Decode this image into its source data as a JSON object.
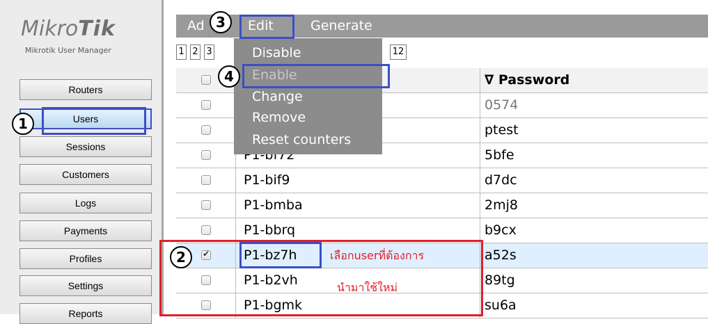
{
  "app": {
    "logo_text": "MikroTik",
    "subtitle": "Mikrotik User Manager"
  },
  "sidebar": {
    "items": [
      {
        "label": "Routers"
      },
      {
        "label": "Users"
      },
      {
        "label": "Sessions"
      },
      {
        "label": "Customers"
      },
      {
        "label": "Logs"
      },
      {
        "label": "Payments"
      },
      {
        "label": "Profiles"
      },
      {
        "label": "Settings"
      },
      {
        "label": "Reports"
      }
    ],
    "active_item": "Users"
  },
  "menubar": {
    "items": [
      "Ad",
      "Edit",
      "Generate"
    ]
  },
  "pager": {
    "pages": [
      "1",
      "2",
      "3",
      "12"
    ]
  },
  "edit_menu": {
    "items": [
      {
        "label": "Disable",
        "enabled": true
      },
      {
        "label": "Enable",
        "enabled": false
      },
      {
        "label": "Change",
        "enabled": true
      },
      {
        "label": "Remove",
        "enabled": true
      },
      {
        "label": "Reset counters",
        "enabled": true
      }
    ]
  },
  "table": {
    "columns": {
      "password": "∇ Password"
    },
    "rows": [
      {
        "username": "",
        "password": "0574",
        "checked": false
      },
      {
        "username": "",
        "password": "ptest",
        "checked": false
      },
      {
        "username": "P1-bf72",
        "password": "5bfe",
        "checked": false
      },
      {
        "username": "P1-bif9",
        "password": "d7dc",
        "checked": false
      },
      {
        "username": "P1-bmba",
        "password": "2mj8",
        "checked": false
      },
      {
        "username": "P1-bbrq",
        "password": "b9cx",
        "checked": false
      },
      {
        "username": "P1-bz7h",
        "password": "a52s",
        "checked": true
      },
      {
        "username": "P1-b2vh",
        "password": "89tg",
        "checked": false
      },
      {
        "username": "P1-bgmk",
        "password": "su6a",
        "checked": false
      }
    ]
  },
  "annotations": {
    "steps": [
      "1",
      "2",
      "3",
      "4"
    ],
    "note_line1": "เลือกuserที่ต้องการ",
    "note_line2": "นำมาใช้ใหม่",
    "colors": {
      "highlight": "#3b4fc4",
      "note": "#e0202a",
      "menubar": "#9a9a9a"
    }
  }
}
